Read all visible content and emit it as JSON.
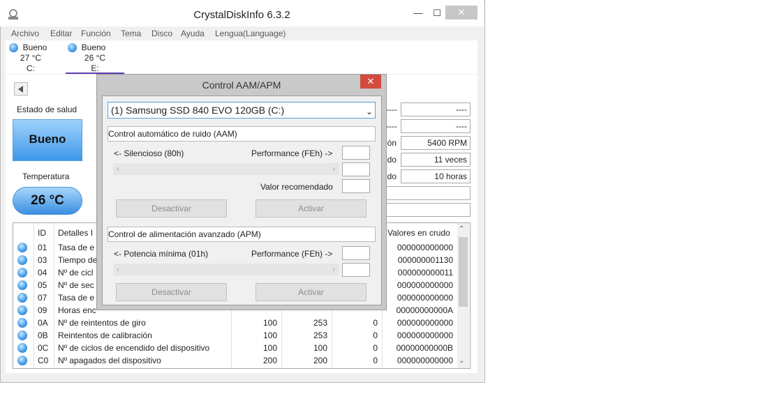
{
  "window": {
    "title": "CrystalDiskInfo 6.3.2"
  },
  "menu": [
    "Archivo",
    "Editar",
    "Función",
    "Tema",
    "Disco",
    "Ayuda",
    "Lengua(Language)"
  ],
  "drives": [
    {
      "status": "Bueno",
      "temp": "27 °C",
      "letter": "C:"
    },
    {
      "status": "Bueno",
      "temp": "26 °C",
      "letter": "E:"
    }
  ],
  "health": {
    "label": "Estado de salud",
    "value": "Bueno"
  },
  "temperature": {
    "label": "Temperatura",
    "value": "26 °C"
  },
  "right_fields": {
    "f1": "----",
    "f2": "----",
    "rotation_label": "ión",
    "rotation": "5400 RPM",
    "count_label": "ido",
    "count": "11 veces",
    "hours_label": "ido",
    "hours": "10 horas",
    "prefix1": "----",
    "prefix2": "----"
  },
  "table": {
    "headers": {
      "id": "ID",
      "details": "Detalles I",
      "raw": "Valores en crudo"
    },
    "rows": [
      {
        "id": "01",
        "name": "Tasa de e",
        "cur": "",
        "worst": "",
        "thr": "",
        "raw": "000000000000"
      },
      {
        "id": "03",
        "name": "Tiempo de",
        "cur": "",
        "worst": "",
        "thr": "",
        "raw": "000000001130"
      },
      {
        "id": "04",
        "name": "Nº de cicl",
        "cur": "",
        "worst": "",
        "thr": "",
        "raw": "000000000011"
      },
      {
        "id": "05",
        "name": "Nº de sec",
        "cur": "",
        "worst": "",
        "thr": "",
        "raw": "000000000000"
      },
      {
        "id": "07",
        "name": "Tasa de e",
        "cur": "",
        "worst": "",
        "thr": "",
        "raw": "000000000000"
      },
      {
        "id": "09",
        "name": "Horas enc",
        "cur": "",
        "worst": "",
        "thr": "",
        "raw": "00000000000A"
      },
      {
        "id": "0A",
        "name": "Nº de reintentos de giro",
        "cur": "100",
        "worst": "253",
        "thr": "0",
        "raw": "000000000000"
      },
      {
        "id": "0B",
        "name": "Reintentos de calibración",
        "cur": "100",
        "worst": "253",
        "thr": "0",
        "raw": "000000000000"
      },
      {
        "id": "0C",
        "name": "Nº de ciclos de encendido del dispositivo",
        "cur": "100",
        "worst": "100",
        "thr": "0",
        "raw": "00000000000B"
      },
      {
        "id": "C0",
        "name": "Nº apagados del dispositivo",
        "cur": "200",
        "worst": "200",
        "thr": "0",
        "raw": "000000000000"
      }
    ]
  },
  "dialog": {
    "title": "Control AAM/APM",
    "close": "✕",
    "drive": "(1) Samsung SSD 840 EVO 120GB  (C:)",
    "aam": {
      "group": "Control automático de ruido (AAM)",
      "left": "<- Silencioso (80h)",
      "right": "Performance (FEh) ->",
      "recommended": "Valor recomendado",
      "disable": "Desactivar",
      "enable": "Activar"
    },
    "apm": {
      "group": "Control de alimentación avanzado (APM)",
      "left": "<- Potencia mínima (01h)",
      "right": "Performance (FEh) ->",
      "disable": "Desactivar",
      "enable": "Activar"
    }
  }
}
